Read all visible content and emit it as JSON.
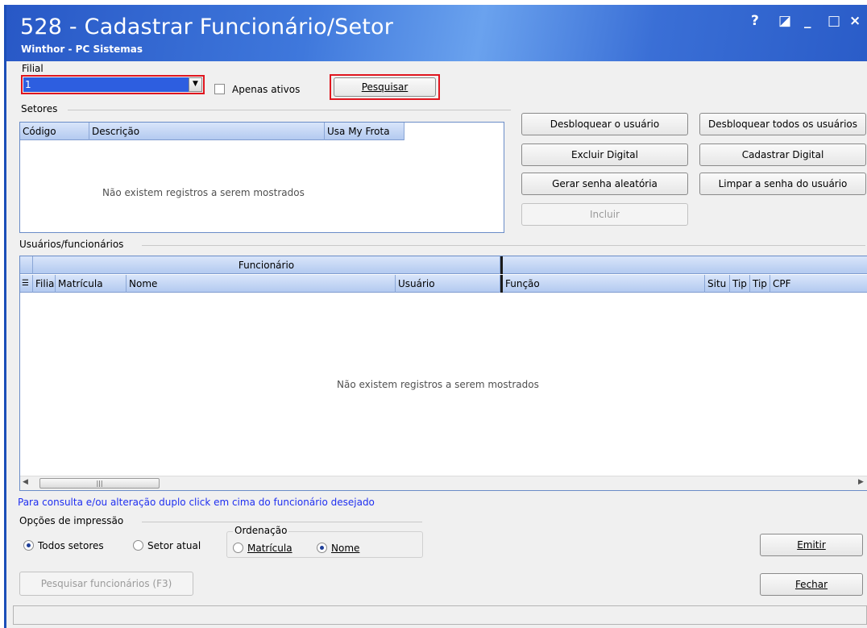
{
  "window": {
    "title": "528 - Cadastrar Funcionário/Setor",
    "subtitle": "Winthor - PC Sistemas",
    "controls": [
      "?",
      "◪",
      "_",
      "□",
      "×"
    ]
  },
  "filter": {
    "filial_label": "Filial",
    "filial_value": "1",
    "apenas_ativos_label": "Apenas ativos",
    "apenas_ativos_checked": false,
    "pesquisar_label": "Pesquisar"
  },
  "setores": {
    "label": "Setores",
    "columns": [
      "Código",
      "Descrição",
      "Usa My Frota"
    ],
    "empty_text": "Não existem registros a serem mostrados"
  },
  "actions": {
    "desbloquear_usuario": "Desbloquear o usuário",
    "desbloquear_todos": "Desbloquear todos os usuários",
    "excluir_digital": "Excluir Digital",
    "cadastrar_digital": "Cadastrar Digital",
    "gerar_senha": "Gerar senha aleatória",
    "limpar_senha": "Limpar a senha do usuário",
    "incluir": "Incluir"
  },
  "usuarios": {
    "label": "Usuários/funcionários",
    "band_funcionario": "Funcionário",
    "columns": [
      "Filia",
      "Matrícula",
      "Nome",
      "Usuário",
      "Função",
      "Situ",
      "Tip",
      "Tip",
      "CPF"
    ],
    "empty_text": "Não existem registros a serem mostrados"
  },
  "hint": "Para consulta e/ou alteração duplo click em cima do funcionário desejado",
  "impressao": {
    "label": "Opções de impressão",
    "todos_setores": "Todos setores",
    "setor_atual": "Setor atual",
    "selected": "Todos setores"
  },
  "ordenacao": {
    "label": "Ordenação",
    "matricula": "Matrícula",
    "nome": "Nome",
    "selected": "Nome"
  },
  "footer": {
    "emitir": "Emitir",
    "pesquisar_funcionarios": "Pesquisar funcionários (F3)",
    "fechar": "Fechar"
  },
  "colors": {
    "title_bar": "#2f63cf",
    "highlight": "#e0161f",
    "grid_header": "#b3caf0",
    "hint_text": "#1f2ff0"
  }
}
